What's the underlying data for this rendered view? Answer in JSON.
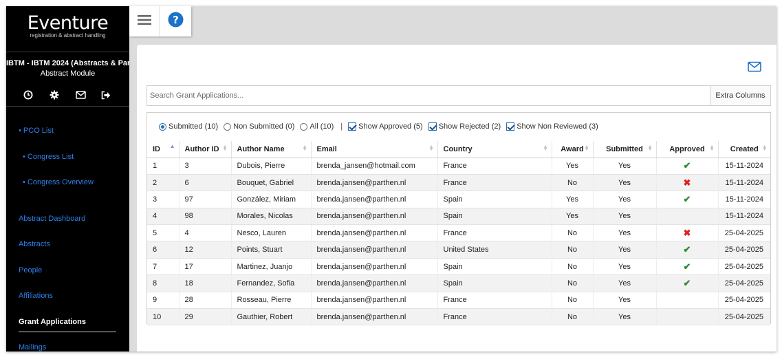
{
  "app": {
    "logo_name": "Eventure",
    "logo_tagline": "registration & abstract handling",
    "event_title": "IBTM - IBTM 2024 (Abstracts & Par...",
    "module_title": "Abstract Module"
  },
  "sidebar": {
    "icons": [
      "clock-icon",
      "gear-icon",
      "envelope-icon",
      "sign-out-icon"
    ],
    "items": [
      {
        "label": "• PCO List"
      },
      {
        "label": "• Congress List"
      },
      {
        "label": "• Congress Overview"
      },
      {
        "label": "Abstract Dashboard"
      },
      {
        "label": "Abstracts"
      },
      {
        "label": "People"
      },
      {
        "label": "Affiliations"
      },
      {
        "label": "Grant Applications",
        "active": true
      },
      {
        "label": "Mailings"
      }
    ]
  },
  "topbar": {
    "icons": [
      "hamburger-menu-icon",
      "help-icon"
    ],
    "help_color": "#1a73c7"
  },
  "search": {
    "placeholder": "Search Grant Applications...",
    "value": "",
    "extra_columns_label": "Extra Columns"
  },
  "filters": {
    "radios": [
      {
        "label": "Submitted (10)",
        "checked": true
      },
      {
        "label": "Non Submitted (0)",
        "checked": false
      },
      {
        "label": "All (10)",
        "checked": false
      }
    ],
    "separator": "|",
    "checkboxes": [
      {
        "label": "Show Approved (5)",
        "checked": true
      },
      {
        "label": "Show Rejected (2)",
        "checked": true
      },
      {
        "label": "Show Non Reviewed (3)",
        "checked": true
      }
    ]
  },
  "table": {
    "columns": [
      "ID",
      "Author ID",
      "Author Name",
      "Email",
      "Country",
      "Award",
      "Submitted",
      "Approved",
      "Created"
    ],
    "rows": [
      {
        "id": "1",
        "author_id": "3",
        "author_name": "Dubois, Pierre",
        "email": "brenda_jansen@hotmail.com",
        "country": "France",
        "award": "Yes",
        "submitted": "Yes",
        "approved": "approved",
        "created": "15-11-2024"
      },
      {
        "id": "2",
        "author_id": "6",
        "author_name": "Bouquet, Gabriel",
        "email": "brenda.jansen@parthen.nl",
        "country": "France",
        "award": "No",
        "submitted": "Yes",
        "approved": "rejected",
        "created": "15-11-2024"
      },
      {
        "id": "3",
        "author_id": "97",
        "author_name": "González, Miriam",
        "email": "brenda.jansen@parthen.nl",
        "country": "Spain",
        "award": "Yes",
        "submitted": "Yes",
        "approved": "approved",
        "created": "15-11-2024"
      },
      {
        "id": "4",
        "author_id": "98",
        "author_name": "Morales, Nicolas",
        "email": "brenda.jansen@parthen.nl",
        "country": "Spain",
        "award": "Yes",
        "submitted": "Yes",
        "approved": "",
        "created": "15-11-2024"
      },
      {
        "id": "5",
        "author_id": "4",
        "author_name": "Nesco, Lauren",
        "email": "brenda.jansen@parthen.nl",
        "country": "France",
        "award": "No",
        "submitted": "Yes",
        "approved": "rejected",
        "created": "25-04-2025"
      },
      {
        "id": "6",
        "author_id": "12",
        "author_name": "Points, Stuart",
        "email": "brenda.jansen@parthen.nl",
        "country": "United States",
        "award": "No",
        "submitted": "Yes",
        "approved": "approved",
        "created": "25-04-2025"
      },
      {
        "id": "7",
        "author_id": "17",
        "author_name": "Martinez, Juanjo",
        "email": "brenda.jansen@parthen.nl",
        "country": "Spain",
        "award": "No",
        "submitted": "Yes",
        "approved": "approved",
        "created": "25-04-2025"
      },
      {
        "id": "8",
        "author_id": "18",
        "author_name": "Fernandez, Sofia",
        "email": "brenda.jansen@parthen.nl",
        "country": "Spain",
        "award": "No",
        "submitted": "Yes",
        "approved": "approved",
        "created": "25-04-2025"
      },
      {
        "id": "9",
        "author_id": "28",
        "author_name": "Rosseau, Pierre",
        "email": "brenda.jansen@parthen.nl",
        "country": "France",
        "award": "No",
        "submitted": "Yes",
        "approved": "",
        "created": "25-04-2025"
      },
      {
        "id": "10",
        "author_id": "29",
        "author_name": "Gauthier, Robert",
        "email": "brenda.jansen@parthen.nl",
        "country": "France",
        "award": "No",
        "submitted": "Yes",
        "approved": "",
        "created": "25-04-2025"
      }
    ],
    "sorted_column": "ID",
    "sort_direction": "asc"
  },
  "colors": {
    "sidebar_bg": "#000000",
    "link": "#2f80ed",
    "approved": "#2e8b2e",
    "rejected": "#e02020"
  }
}
